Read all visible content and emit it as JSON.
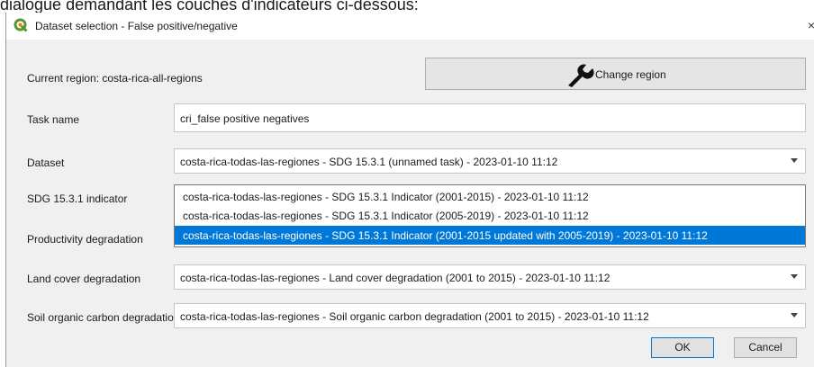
{
  "background_text": "dialogue demandant les couches d'indicateurs ci-dessous:",
  "window": {
    "title": "Dataset selection - False positive/negative",
    "close_glyph": "×",
    "logo_icon": "qgis-logo-icon"
  },
  "region": {
    "label": "Current region: costa-rica-all-regions",
    "button_label": "Change region",
    "button_icon": "wrench-icon"
  },
  "task": {
    "label": "Task name",
    "value": "cri_false positive negatives"
  },
  "dataset": {
    "label": "Dataset",
    "value": "costa-rica-todas-las-regiones - SDG 15.3.1 (unnamed task) - 2023-01-10 11:12"
  },
  "sdg": {
    "label": "SDG 15.3.1 indicator",
    "options": [
      "costa-rica-todas-las-regiones - SDG 15.3.1 Indicator (2001-2015) - 2023-01-10 11:12",
      "costa-rica-todas-las-regiones - SDG 15.3.1 Indicator (2005-2019) - 2023-01-10 11:12",
      "costa-rica-todas-las-regiones - SDG 15.3.1 Indicator (2001-2015 updated with 2005-2019) - 2023-01-10 11:12"
    ],
    "selected_index": 2
  },
  "productivity": {
    "label": "Productivity degradation"
  },
  "land_cover": {
    "label": "Land cover degradation",
    "value": "costa-rica-todas-las-regiones - Land cover degradation (2001 to 2015) - 2023-01-10 11:12"
  },
  "soc": {
    "label": "Soil organic carbon degradation",
    "value": "costa-rica-todas-las-regiones - Soil organic carbon degradation (2001 to 2015) - 2023-01-10 11:12"
  },
  "buttons": {
    "ok": "OK",
    "cancel": "Cancel"
  },
  "colors": {
    "selection": "#0078d7",
    "dialog_bg": "#f0f0f0",
    "qgis_green": "#589632",
    "qgis_yellow": "#ee7913"
  }
}
